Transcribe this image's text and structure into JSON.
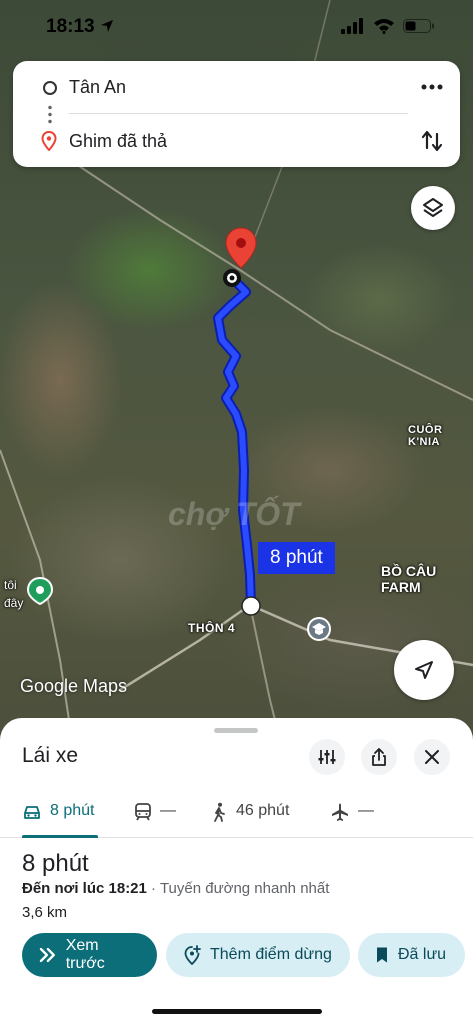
{
  "status_bar": {
    "time": "18:13"
  },
  "search": {
    "origin": "Tân An",
    "destination": "Ghim đã thả"
  },
  "map": {
    "labels": {
      "cuor": "CUÔR K'NIA",
      "bocau": "BỒ CÂU FARM",
      "thon4": "THÔN 4",
      "toi_line1": "tôi",
      "toi_line2": "đây"
    },
    "watermark": "chợ TỐT",
    "attribution": "Google Maps",
    "route_label": "8 phút",
    "route_color": "#1a33e6"
  },
  "sheet": {
    "title": "Lái xe",
    "modes": [
      {
        "icon": "car-icon",
        "label": "8 phút",
        "active": true
      },
      {
        "icon": "transit-icon",
        "label": "—",
        "active": false
      },
      {
        "icon": "walk-icon",
        "label": "46 phút",
        "active": false
      },
      {
        "icon": "flight-icon",
        "label": "—",
        "active": false
      }
    ],
    "trip_time": "8 phút",
    "arrival_prefix": "Đến nơi lúc 18:21",
    "arrival_separator": " · ",
    "arrival_note": "Tuyến đường nhanh nhất",
    "distance": "3,6 km",
    "actions": {
      "preview": "Xem trước",
      "add_stop": "Thêm điểm dừng",
      "saved": "Đã lưu"
    }
  },
  "colors": {
    "accent": "#0b6e78",
    "pill_light": "#d7eef5",
    "pin": "#ea4335"
  }
}
